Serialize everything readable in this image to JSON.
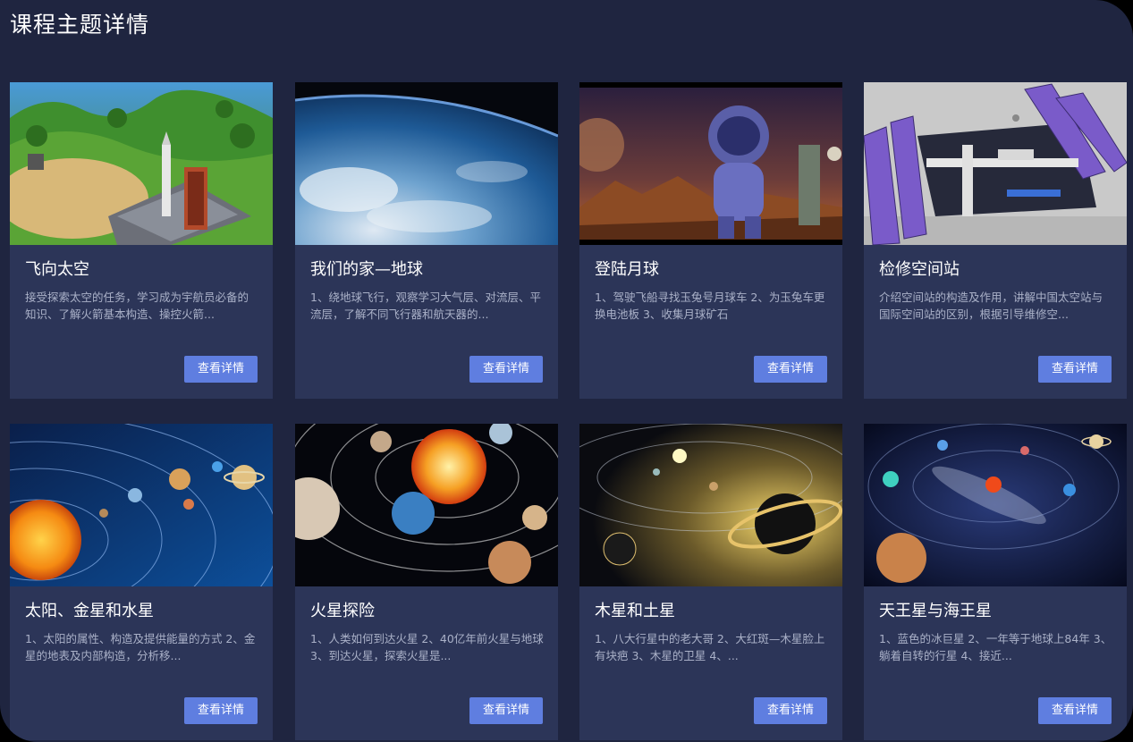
{
  "page": {
    "title": "课程主题详情",
    "background_color": "#1f2540",
    "card_color": "#2c3558",
    "button_color": "#5f7ee0"
  },
  "cards": [
    {
      "title": "飞向太空",
      "description": "接受探索太空的任务，学习成为宇航员必备的知识、了解火箭基本构造、操控火箭...",
      "button_label": "查看详情",
      "image_subject": "rocket-launch-base-image"
    },
    {
      "title": "我们的家—地球",
      "description": "1、绕地球飞行，观察学习大气层、对流层、平流层，了解不同飞行器和航天器的...",
      "button_label": "查看详情",
      "image_subject": "earth-from-space-image"
    },
    {
      "title": "登陆月球",
      "description": "1、驾驶飞船寻找玉兔号月球车 2、为玉兔车更换电池板 3、收集月球矿石",
      "button_label": "查看详情",
      "image_subject": "astronaut-on-planet-image"
    },
    {
      "title": "检修空间站",
      "description": "介绍空间站的构造及作用，讲解中国太空站与国际空间站的区别，根据引导维修空...",
      "button_label": "查看详情",
      "image_subject": "space-station-model-image"
    },
    {
      "title": "太阳、金星和水星",
      "description": "1、太阳的属性、构造及提供能量的方式 2、金星的地表及内部构造，分析移...",
      "button_label": "查看详情",
      "image_subject": "solar-system-sun-image"
    },
    {
      "title": "火星探险",
      "description": "1、人类如何到达火星 2、40亿年前火星与地球 3、到达火星，探索火星是...",
      "button_label": "查看详情",
      "image_subject": "planets-orbits-image"
    },
    {
      "title": "木星和土星",
      "description": "1、八大行星中的老大哥 2、大红斑—木星脸上有块疤 3、木星的卫星 4、...",
      "button_label": "查看详情",
      "image_subject": "saturn-ring-image"
    },
    {
      "title": "天王星与海王星",
      "description": "1、蓝色的冰巨星 2、一年等于地球上84年 3、躺着自转的行星 4、接近...",
      "button_label": "查看详情",
      "image_subject": "galaxy-planets-image"
    }
  ]
}
